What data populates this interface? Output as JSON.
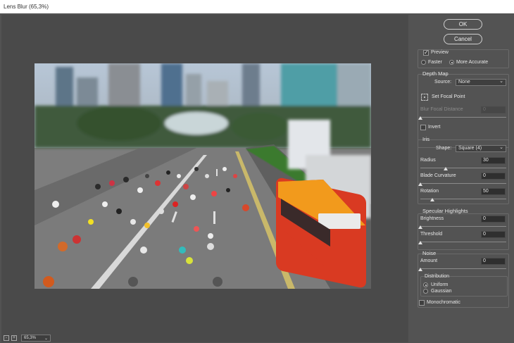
{
  "window": {
    "title": "Lens Blur (65,3%)"
  },
  "status": {
    "zoom": "65,3%",
    "zoom_chevron": "⌄",
    "icon1": "-",
    "icon2": "+"
  },
  "buttons": {
    "ok": "OK",
    "cancel": "Cancel"
  },
  "preview": {
    "label": "Preview",
    "checked": true,
    "faster": "Faster",
    "more_accurate": "More Accurate",
    "selected": "More Accurate"
  },
  "depth_map": {
    "title": "Depth Map",
    "source_label": "Source:",
    "source_value": "None",
    "set_focal_point": "Set Focal Point",
    "blur_focal_distance_label": "Blur Focal Distance",
    "blur_focal_distance_value": "0",
    "blur_focal_distance_level": 0,
    "invert_label": "Invert",
    "invert_checked": false
  },
  "iris": {
    "title": "Iris",
    "shape_label": "Shape:",
    "shape_value": "Square (4)",
    "radius_label": "Radius",
    "radius_value": "30",
    "radius_level": 0.3,
    "blade_curvature_label": "Blade Curvature",
    "blade_curvature_value": "0",
    "blade_curvature_level": 0,
    "rotation_label": "Rotation",
    "rotation_value": "50",
    "rotation_level": 0.14
  },
  "specular": {
    "title": "Specular Highlights",
    "brightness_label": "Brightness",
    "brightness_value": "0",
    "brightness_level": 0,
    "threshold_label": "Threshold",
    "threshold_value": "0",
    "threshold_level": 0
  },
  "noise": {
    "title": "Noise",
    "amount_label": "Amount",
    "amount_value": "0",
    "amount_level": 0,
    "distribution_title": "Distribution",
    "uniform": "Uniform",
    "gaussian": "Gaussian",
    "selected": "Uniform",
    "monochromatic_label": "Monochromatic",
    "monochromatic_checked": false
  },
  "icons": {
    "chevron": "⌄",
    "focal": "crosshair-icon"
  },
  "colors": {
    "panel_bg": "#535353",
    "canvas_bg": "#4a4a4a",
    "bus": "#f29a1c",
    "bus_red": "#d93a22"
  }
}
